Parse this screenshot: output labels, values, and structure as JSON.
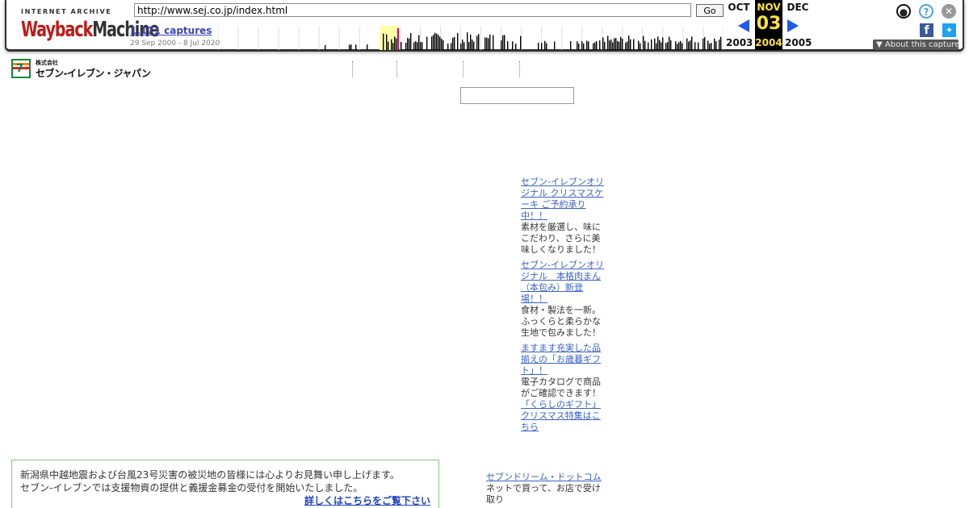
{
  "wayback": {
    "logo_top": "INTERNET ARCHIVE",
    "logo_word1": "Wayback",
    "logo_word2": "Machine",
    "url": "http://www.sej.co.jp/index.html",
    "go_label": "Go",
    "captures": "1,171 captures",
    "range": "29 Sep 2000 - 8 Jul 2020",
    "prev_month": "OCT",
    "prev_year": "2003",
    "cur_month": "NOV",
    "cur_day": "03",
    "cur_year": "2004",
    "next_month": "DEC",
    "next_year": "2005",
    "about": "About this capture",
    "user_icon": "user-icon",
    "help_icon": "help-icon",
    "close_icon": "close-icon",
    "accent": "#2159e8",
    "highlight": "#ffe23a"
  },
  "page": {
    "logo_corp": "株式会社",
    "logo_name": "セブン-イレブン・ジャパン",
    "logo_badge": "7",
    "news": [
      {
        "link": "セブン-イレブンオリジナル クリスマスケーキ ご予約承り中！！",
        "desc": "素材を厳選し、味にこだわり、さらに美味しくなりました！"
      },
      {
        "link": "セブン-イレブンオリジナル　本格肉まん（本包み）新登場！！",
        "desc": "食材・製法を一新。ふっくらと柔らかな生地で包みました！"
      },
      {
        "link": "ますます充実した品揃えの「お歳暮ギフト」！",
        "desc": "電子カタログで商品がご確認できます！"
      },
      {
        "link": "「くらしのギフト」クリスマス特集はこちら",
        "desc": ""
      }
    ],
    "notice_line1": "新潟県中越地震および台風23号災害の被災地の皆様には心よりお見舞い申し上げます。",
    "notice_line2": "セブン-イレブンでは支援物資の提供と義援金募金の受付を開始いたしました。",
    "notice_more": "詳しくはこちらをご覧下さい",
    "dream_link": "セブンドリーム・ドットコム",
    "dream_desc": "ネットで買って、お店で受け取り"
  }
}
